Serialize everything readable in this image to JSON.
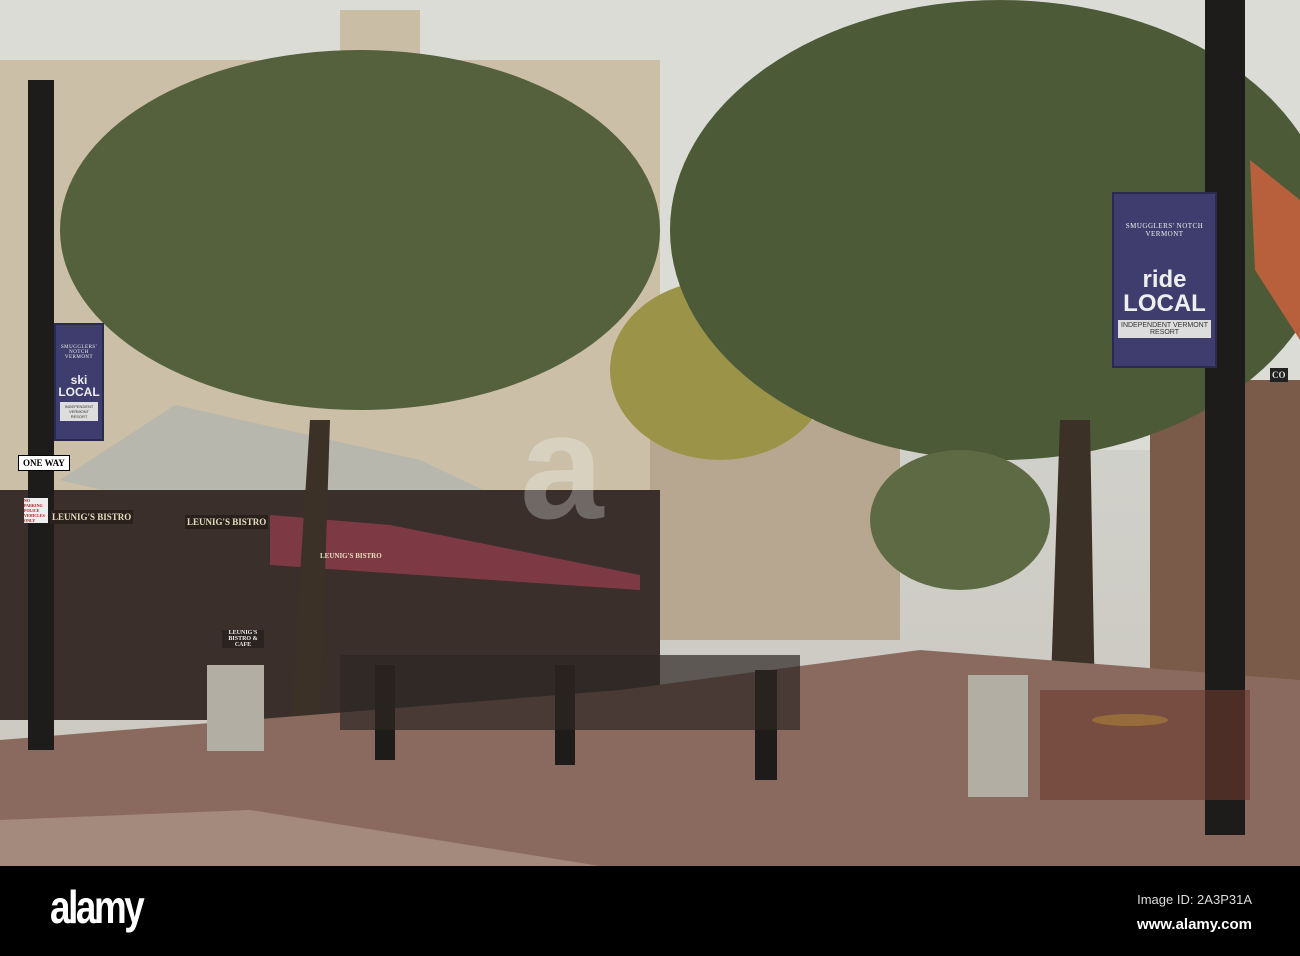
{
  "photo": {
    "watermark": "a",
    "signs": {
      "one_way": "ONE WAY",
      "bistro_left": "LEUNIG'S BISTRO",
      "bistro_mid": "LEUNIG'S BISTRO",
      "awning": "LEUNIG'S BISTRO",
      "cafe_board": "LEUNIG'S BISTRO & CAFE",
      "no_parking": "NO PARKING POLICE VEHICLES ONLY",
      "street_sign_partial": "CO"
    },
    "banner_left": {
      "brand": "SMUGGLERS' NOTCH VERMONT",
      "slogan": "ski LOCAL",
      "footer": "INDEPENDENT VERMONT RESORT"
    },
    "banner_right": {
      "brand": "SMUGGLERS' NOTCH VERMONT",
      "slogan": "ride LOCAL",
      "footer": "INDEPENDENT VERMONT RESORT"
    }
  },
  "footer": {
    "logo": "alamy",
    "image_id": "Image ID: 2A3P31A",
    "url": "www.alamy.com"
  }
}
